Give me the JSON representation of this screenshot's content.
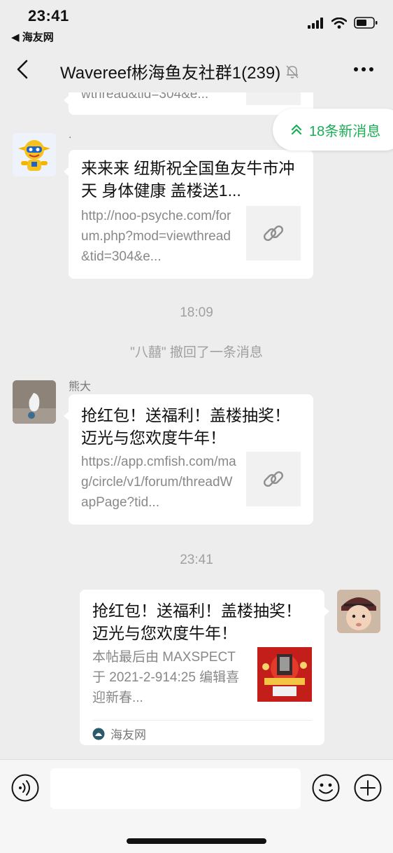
{
  "status_bar": {
    "time": "23:41",
    "back_app": "◀ 海友网"
  },
  "header": {
    "title": "Wavereef彬海鱼友社群1(239)"
  },
  "new_messages_pill": {
    "label": "18条新消息"
  },
  "messages": {
    "partial_top": {
      "url_tail": "wthread&tid=304&e..."
    },
    "msg1": {
      "sender": ".",
      "title": "来来来 纽斯祝全国鱼友牛市冲天 身体健康 盖楼送1...",
      "url": "http://noo-psyche.com/forum.php?mod=viewthread&tid=304&e..."
    },
    "timestamp1": "18:09",
    "recall": "\"八囍\" 撤回了一条消息",
    "msg2": {
      "sender": "熊大",
      "title": "抢红包！送福利！盖楼抽奖！迈光与您欢度牛年！",
      "url": "https://app.cmfish.com/mag/circle/v1/forum/threadWapPage?tid..."
    },
    "timestamp2": "23:41",
    "msg3": {
      "title": "抢红包！送福利！盖楼抽奖！迈光与您欢度牛年！",
      "desc": "本帖最后由 MAXSPECT 于 2021-2-914:25 编辑喜迎新春...",
      "source": "海友网"
    }
  },
  "colors": {
    "background": "#ededed",
    "accent_green": "#1aad56",
    "bubble": "#ffffff"
  }
}
